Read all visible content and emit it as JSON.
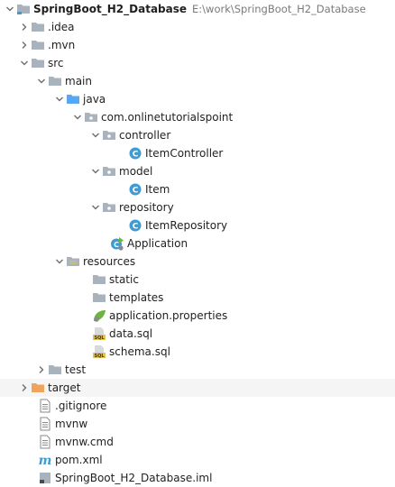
{
  "project_tree": {
    "root": {
      "name": "SpringBoot_H2_Database",
      "path": "E:\\work\\SpringBoot_H2_Database",
      "icon": "project-folder-icon"
    },
    "items": [
      {
        "label": ".idea",
        "icon": "folder-icon",
        "expanded": false
      },
      {
        "label": ".mvn",
        "icon": "folder-icon",
        "expanded": false
      },
      {
        "label": "src",
        "icon": "folder-icon",
        "expanded": true
      },
      {
        "label": "main",
        "icon": "folder-icon",
        "expanded": true
      },
      {
        "label": "java",
        "icon": "source-folder-icon",
        "expanded": true
      },
      {
        "label": "com.onlinetutorialspoint",
        "icon": "package-icon",
        "expanded": true
      },
      {
        "label": "controller",
        "icon": "package-icon",
        "expanded": true
      },
      {
        "label": "ItemController",
        "icon": "java-class-icon"
      },
      {
        "label": "model",
        "icon": "package-icon",
        "expanded": true
      },
      {
        "label": "Item",
        "icon": "java-class-icon"
      },
      {
        "label": "repository",
        "icon": "package-icon",
        "expanded": true
      },
      {
        "label": "ItemRepository",
        "icon": "java-class-icon"
      },
      {
        "label": "Application",
        "icon": "spring-boot-app-icon"
      },
      {
        "label": "resources",
        "icon": "resources-folder-icon",
        "expanded": true
      },
      {
        "label": "static",
        "icon": "folder-icon"
      },
      {
        "label": "templates",
        "icon": "folder-icon"
      },
      {
        "label": "application.properties",
        "icon": "spring-properties-icon"
      },
      {
        "label": "data.sql",
        "icon": "sql-file-icon"
      },
      {
        "label": "schema.sql",
        "icon": "sql-file-icon"
      },
      {
        "label": "test",
        "icon": "folder-icon",
        "expanded": false
      },
      {
        "label": "target",
        "icon": "excluded-folder-icon",
        "expanded": false
      },
      {
        "label": ".gitignore",
        "icon": "text-file-icon"
      },
      {
        "label": "mvnw",
        "icon": "text-file-icon"
      },
      {
        "label": "mvnw.cmd",
        "icon": "text-file-icon"
      },
      {
        "label": "pom.xml",
        "icon": "maven-icon"
      },
      {
        "label": "SpringBoot_H2_Database.iml",
        "icon": "module-file-icon"
      }
    ]
  },
  "colors": {
    "folder": "#a9b3bd",
    "source_folder": "#56a8f5",
    "excluded_folder": "#f0a35a",
    "class_circle": "#3f9bd3",
    "spring_green": "#6db33f",
    "sql_yellow": "#e3c155",
    "selection": "#f5f5f5"
  }
}
